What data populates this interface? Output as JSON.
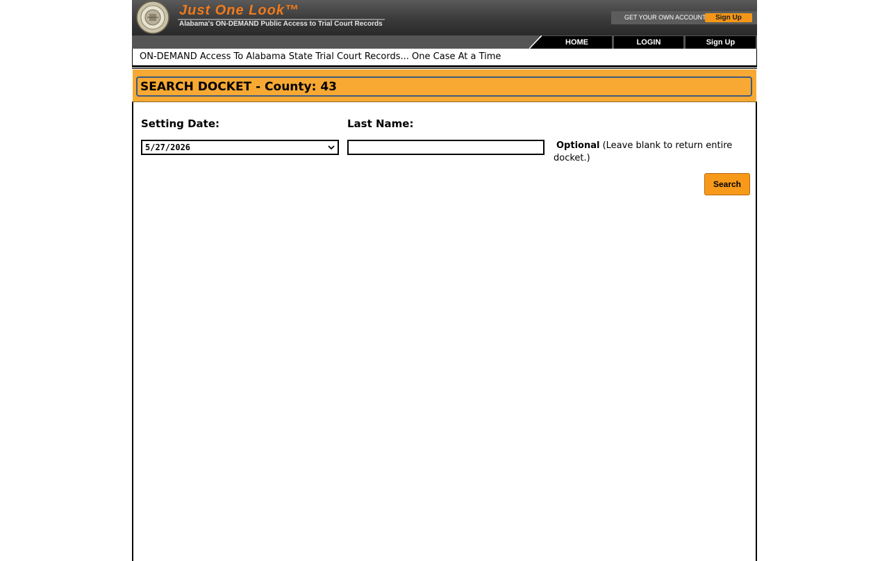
{
  "header": {
    "title": "Just One Look™",
    "subtitle": "Alabama's ON-DEMAND Public Access to Trial Court Records",
    "account_prompt": "GET YOUR OWN ACCOUNT",
    "signup_label": "Sign Up"
  },
  "nav": {
    "items": [
      {
        "label": "HOME"
      },
      {
        "label": "LOGIN"
      },
      {
        "label": "Sign Up"
      }
    ]
  },
  "tagline": "ON-DEMAND Access To Alabama State Trial Court Records... One Case At a Time",
  "section": {
    "title": "SEARCH DOCKET - County: 43"
  },
  "form": {
    "setting_date_label": "Setting Date:",
    "setting_date_value": "5/27/2026",
    "last_name_label": "Last Name:",
    "last_name_value": "",
    "optional_label": "Optional",
    "optional_hint": "(Leave blank to return entire docket.)",
    "search_label": "Search"
  },
  "colors": {
    "accent_orange": "#f7a933",
    "button_orange": "#f79a1a",
    "logo_orange": "#f07a1c",
    "header_dark": "#3a3a3a"
  },
  "icons": {
    "seal": "alabama-judicial-seal-icon",
    "dropdown": "chevron-down-icon"
  }
}
